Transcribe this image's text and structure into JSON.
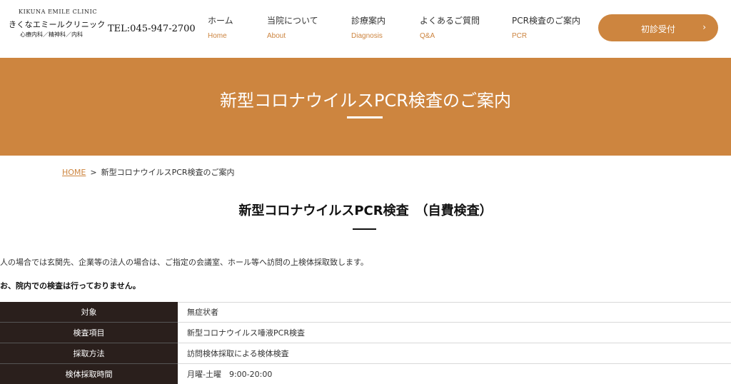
{
  "header": {
    "logo_en": "KIKUNA EMILE CLINIC",
    "logo_ja": "きくなエミールクリニック",
    "logo_sub": "心療内科／精神科／内科",
    "tel": "TEL:045-947-2700",
    "nav": [
      {
        "jp": "ホーム",
        "en": "Home"
      },
      {
        "jp": "当院について",
        "en": "About"
      },
      {
        "jp": "診療案内",
        "en": "Diagnosis"
      },
      {
        "jp": "よくあるご質問",
        "en": "Q&A"
      },
      {
        "jp": "PCR検査のご案内",
        "en": "PCR"
      }
    ],
    "cta_label": "初診受付",
    "cta_chevron": "›"
  },
  "hero": {
    "title": "新型コロナウイルスPCR検査のご案内"
  },
  "breadcrumb": {
    "home": "HOME",
    "separator": ">",
    "current": "新型コロナウイルスPCR検査のご案内"
  },
  "section": {
    "title": "新型コロナウイルスPCR検査　（自費検査）",
    "text1": "人の場合では玄関先、企業等の法人の場合は、ご指定の会議室、ホール等へ訪問の上検体採取致します。",
    "text2": "お、院内での検査は行っておりません。"
  },
  "table": [
    {
      "label": "対象",
      "value": "無症状者"
    },
    {
      "label": "検査項目",
      "value": "新型コロナウイルス唾液PCR検査"
    },
    {
      "label": "採取方法",
      "value": "訪問検体採取による検体検査"
    },
    {
      "label": "検体採取時間",
      "value": "月曜-土曜　9:00-20:00"
    }
  ],
  "colors": {
    "accent": "#cd853f",
    "table_header_bg": "#2a1f1c"
  }
}
